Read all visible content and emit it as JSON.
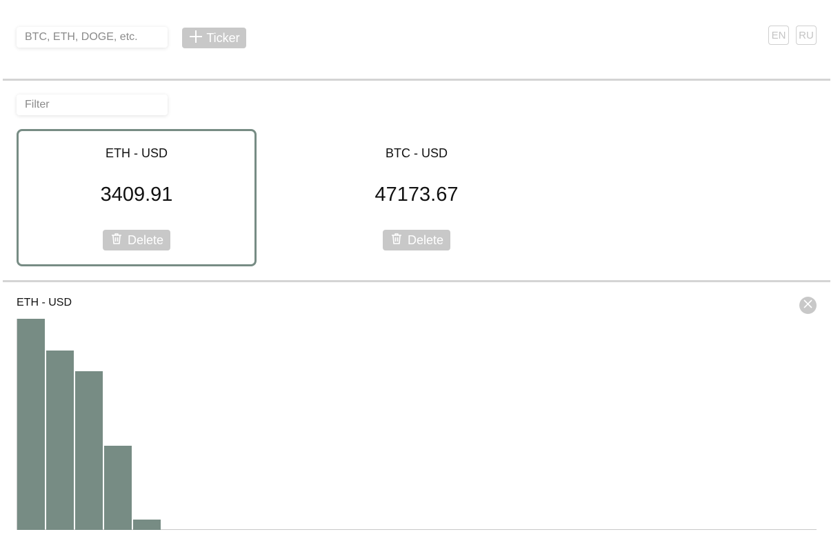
{
  "header": {
    "ticker_input": {
      "placeholder": "BTC, ETH, DOGE, etc.",
      "value": ""
    },
    "add_button_label": "Ticker",
    "languages": [
      "EN",
      "RU"
    ]
  },
  "filter": {
    "placeholder": "Filter",
    "value": ""
  },
  "tickers": [
    {
      "name": "ETH - USD",
      "price": "3409.91",
      "delete_label": "Delete",
      "selected": true
    },
    {
      "name": "BTC - USD",
      "price": "47173.67",
      "delete_label": "Delete",
      "selected": false
    }
  ],
  "graph": {
    "title": "ETH - USD"
  },
  "chart_data": {
    "type": "bar",
    "title": "ETH - USD",
    "values": [
      1.0,
      0.85,
      0.75,
      0.4,
      0.05
    ],
    "ylim": [
      0,
      1
    ],
    "grid": false,
    "color": "#778c84"
  },
  "colors": {
    "accent": "#778c84",
    "button_bg": "#c8c8c8",
    "divider": "#d4d4d4"
  }
}
